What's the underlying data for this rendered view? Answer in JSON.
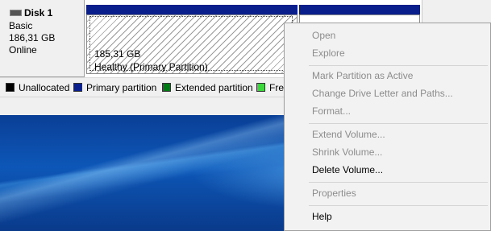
{
  "disk": {
    "title": "Disk 1",
    "type": "Basic",
    "size": "186,31 GB",
    "status": "Online"
  },
  "partition": {
    "size": "185,31 GB",
    "status": "Healthy (Primary Partition)"
  },
  "legend": [
    {
      "label": "Unallocated",
      "color": "#000000"
    },
    {
      "label": "Primary partition",
      "color": "#0a1f8c"
    },
    {
      "label": "Extended partition",
      "color": "#007a14"
    },
    {
      "label": "Fre",
      "color": "#3bd83b"
    }
  ],
  "context_menu": {
    "items": [
      {
        "label": "Open",
        "enabled": false
      },
      {
        "label": "Explore",
        "enabled": false
      },
      {
        "label": "Mark Partition as Active",
        "enabled": false
      },
      {
        "label": "Change Drive Letter and Paths...",
        "enabled": false
      },
      {
        "label": "Format...",
        "enabled": false
      },
      {
        "label": "Extend Volume...",
        "enabled": false
      },
      {
        "label": "Shrink Volume...",
        "enabled": false
      },
      {
        "label": "Delete Volume...",
        "enabled": true
      },
      {
        "label": "Properties",
        "enabled": false
      },
      {
        "label": "Help",
        "enabled": true
      }
    ]
  },
  "colors": {
    "primary_partition": "#0a1f8c",
    "menu_disabled_text": "#8c8c8c"
  }
}
